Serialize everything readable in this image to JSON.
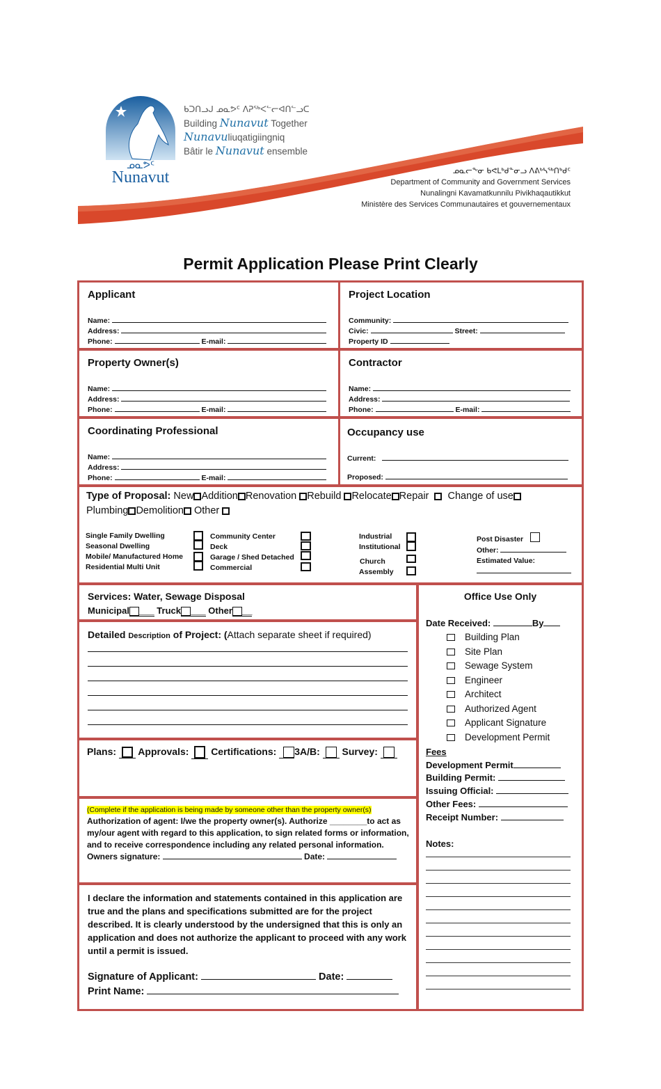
{
  "header": {
    "tagline_syllabics": "ᑲᑐᑎᓗᒍ ᓄᓇᕗᑦ ᐱᕈᖅᐸᓪᓕᐊᑎᓪᓗᑕ",
    "tagline_en_pre": "Building ",
    "tagline_en_nv": "Nunavut",
    "tagline_en_post": " Together",
    "tagline_iu_nv": "Nunavu",
    "tagline_iu_post": "liuqatigiingniq",
    "tagline_fr_pre": "Bâtir le ",
    "tagline_fr_nv": "Nunavut",
    "tagline_fr_post": " ensemble",
    "logo_syllabics": "ᓄᓇᕗᑦ",
    "logo_word": "Nunavut",
    "dept_syllabics": "ᓄᓇᓕᖕᓂ ᑲᕙᒪᒃᑯᓐᓂᓗ ᐱᕕᒃᓴᖅᑎᒃᑯᑦ",
    "dept_en": "Department of Community and Government Services",
    "dept_iu": "Nunalingni Kavamatkunnilu Pivikhaqautikkut",
    "dept_fr": "Ministère des Services Communautaires et gouvernementaux",
    "brand_blue": "#1f6fa6",
    "swoosh_color": "#d9482b"
  },
  "title": "Permit Application Please Print Clearly",
  "border_color": "#c0504d",
  "applicant": {
    "heading": "Applicant",
    "name_label": "Name:",
    "address_label": "Address:",
    "phone_label": "Phone:",
    "email_label": "E-mail:"
  },
  "project_location": {
    "heading": "Project Location",
    "community_label": "Community:",
    "civic_label": "Civic:",
    "street_label": "Street:",
    "property_id_label": "Property ID"
  },
  "property_owner": {
    "heading": "Property Owner(s)",
    "name_label": "Name:",
    "address_label": "Address:",
    "phone_label": "Phone:",
    "email_label": "E-mail:"
  },
  "contractor": {
    "heading": "Contractor",
    "name_label": "Name:",
    "address_label": "Address:",
    "phone_label": "Phone:",
    "email_label": "E-mail:"
  },
  "coordinating_professional": {
    "heading": "Coordinating Professional",
    "name_label": "Name:",
    "address_label": "Address:",
    "phone_label": "Phone:",
    "email_label": "E-mail:"
  },
  "occupancy": {
    "heading": "Occupancy use",
    "current_label": "Current:",
    "proposed_label": "Proposed:"
  },
  "proposal": {
    "label": "Type of Proposal:",
    "types": [
      "New",
      "Addition",
      "Renovation",
      "Rebuild",
      "Relocate",
      "Repair",
      "Change of use",
      "Plumbing",
      "Demolition",
      "Other"
    ],
    "buildings_col1": [
      "Single Family Dwelling",
      "Seasonal Dwelling",
      "Mobile/ Manufactured Home",
      "Residential Multi Unit"
    ],
    "buildings_col2": [
      "Community Center",
      "Deck",
      "Garage / Shed Detached",
      "Commercial"
    ],
    "buildings_col3": [
      "Industrial",
      "Institutional",
      "Church",
      "Assembly"
    ],
    "post_disaster_label": "Post Disaster",
    "other_label": "Other:",
    "estimated_value_label": "Estimated Value:"
  },
  "services": {
    "heading": "Services:  Water, Sewage Disposal",
    "options": [
      "Municipal",
      "Truck",
      "Other"
    ]
  },
  "description": {
    "heading_bold1": "Detailed ",
    "heading_small": "Description",
    "heading_bold2": " of Project:  (",
    "heading_normal": "Attach separate sheet if required)",
    "lines": 6
  },
  "attachments": {
    "items": [
      "Plans:",
      "Approvals:",
      "Certifications:",
      "3A/B:",
      "Survey:"
    ]
  },
  "authorization": {
    "highlight_note": "(Complete if the application is being made by someone other than the property owner(s)",
    "text": "Authorization of agent:  I/we the property owner(s). Authorize ________to act as my/our agent with regard to this application, to sign related forms or information, and to receive correspondence including any related personal information.",
    "owner_signature_label": "Owners signature:",
    "date_label": "Date:",
    "highlight_color": "#ffff00"
  },
  "declaration": {
    "text": "I declare the information and statements contained in this application are true and the plans and specifications submitted are for the project described.  It is clearly understood by the undersigned that this is only an application and does not authorize the applicant to proceed with any work until a permit is issued.",
    "signature_label": "Signature of Applicant:",
    "date_label": "Date:",
    "print_name_label": "Print Name:"
  },
  "office": {
    "heading": "Office Use Only",
    "date_received_label": "Date Received:",
    "by_label": "By",
    "checklist": [
      "Building Plan",
      "Site Plan",
      "Sewage System",
      "Engineer",
      "Architect",
      "Authorized Agent",
      "Applicant Signature",
      "Development Permit"
    ],
    "fees_heading": "Fees",
    "fees": [
      "Development Permit",
      "Building Permit:",
      "Issuing Official:",
      "Other Fees:",
      "Receipt Number:"
    ],
    "notes_label": "Notes:",
    "note_lines": 11
  }
}
